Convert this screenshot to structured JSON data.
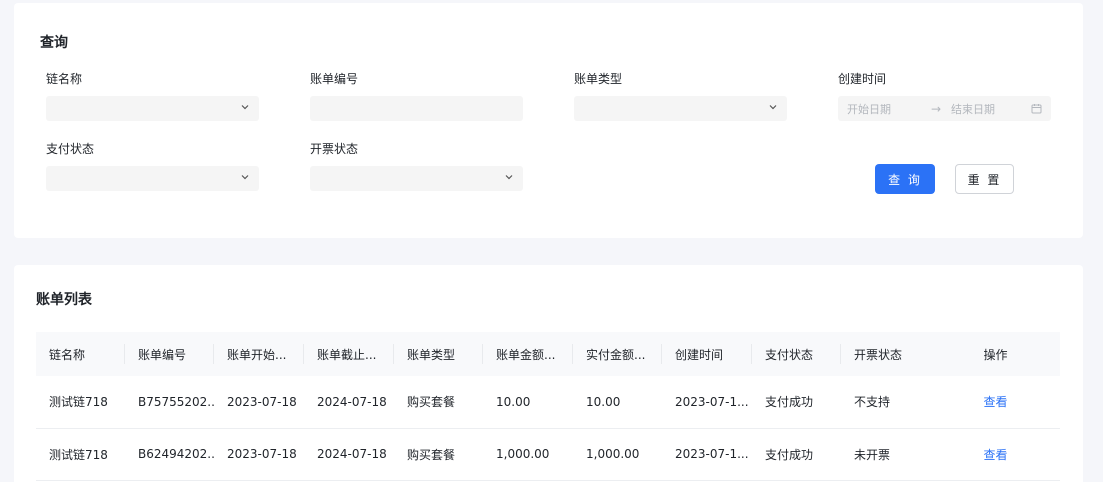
{
  "query": {
    "title": "查询",
    "fields": {
      "chain_name": {
        "label": "链名称",
        "value": ""
      },
      "bill_no": {
        "label": "账单编号",
        "value": "",
        "placeholder": ""
      },
      "bill_type": {
        "label": "账单类型",
        "value": ""
      },
      "created_time": {
        "label": "创建时间",
        "start_placeholder": "开始日期",
        "end_placeholder": "结束日期"
      },
      "pay_status": {
        "label": "支付状态",
        "value": ""
      },
      "invoice_status": {
        "label": "开票状态",
        "value": ""
      }
    },
    "buttons": {
      "query": "查 询",
      "reset": "重 置"
    }
  },
  "list": {
    "title": "账单列表",
    "columns": [
      "链名称",
      "账单编号",
      "账单开始...",
      "账单截止...",
      "账单类型",
      "账单金额...",
      "实付金额...",
      "创建时间",
      "支付状态",
      "开票状态",
      "操作"
    ],
    "rows": [
      [
        "测试链718",
        "B75755202...",
        "2023-07-18",
        "2024-07-18",
        "购买套餐",
        "10.00",
        "10.00",
        "2023-07-1...",
        "支付成功",
        "不支持",
        "查看"
      ],
      [
        "测试链718",
        "B62494202...",
        "2023-07-18",
        "2024-07-18",
        "购买套餐",
        "1,000.00",
        "1,000.00",
        "2023-07-1...",
        "支付成功",
        "未开票",
        "查看"
      ]
    ]
  },
  "icons": {
    "select_arrow": "chevron-down-icon",
    "date_range_arrow": "arrow-right-icon",
    "calendar": "calendar-icon"
  },
  "colors": {
    "primary": "#2b72f6",
    "page_bg": "#f5f6fa",
    "input_bg": "#f5f5f5"
  }
}
